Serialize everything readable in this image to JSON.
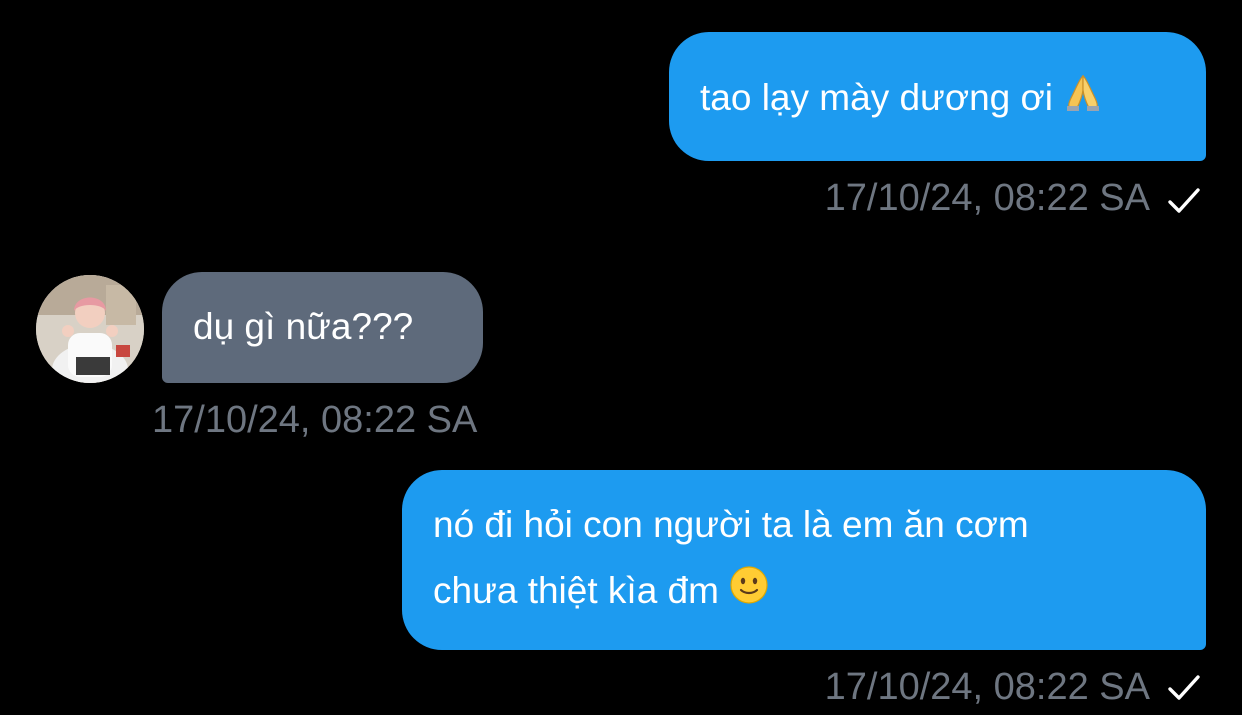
{
  "conversation": {
    "messages": [
      {
        "direction": "outgoing",
        "text": "tao lạy mày dương ơi",
        "emoji": "folded-hands-emoji",
        "timestamp": "17/10/24, 08:22 SA",
        "status": "sent-check-icon"
      },
      {
        "direction": "incoming",
        "text": "dụ gì nữa???",
        "timestamp": "17/10/24, 08:22 SA",
        "avatar": "avatar-photo"
      },
      {
        "direction": "outgoing",
        "line1": "nó đi hỏi con người ta là em ăn cơm",
        "line2": "chưa thiệt kìa đm",
        "emoji": "slightly-smiling-face-emoji",
        "timestamp": "17/10/24, 08:22 SA",
        "status": "sent-check-icon"
      }
    ]
  },
  "colors": {
    "background": "#000000",
    "outgoing_bubble": "#1d9bf0",
    "incoming_bubble": "#5e6a7b",
    "timestamp_text": "#6e7681",
    "check_icon": "#ffffff"
  }
}
